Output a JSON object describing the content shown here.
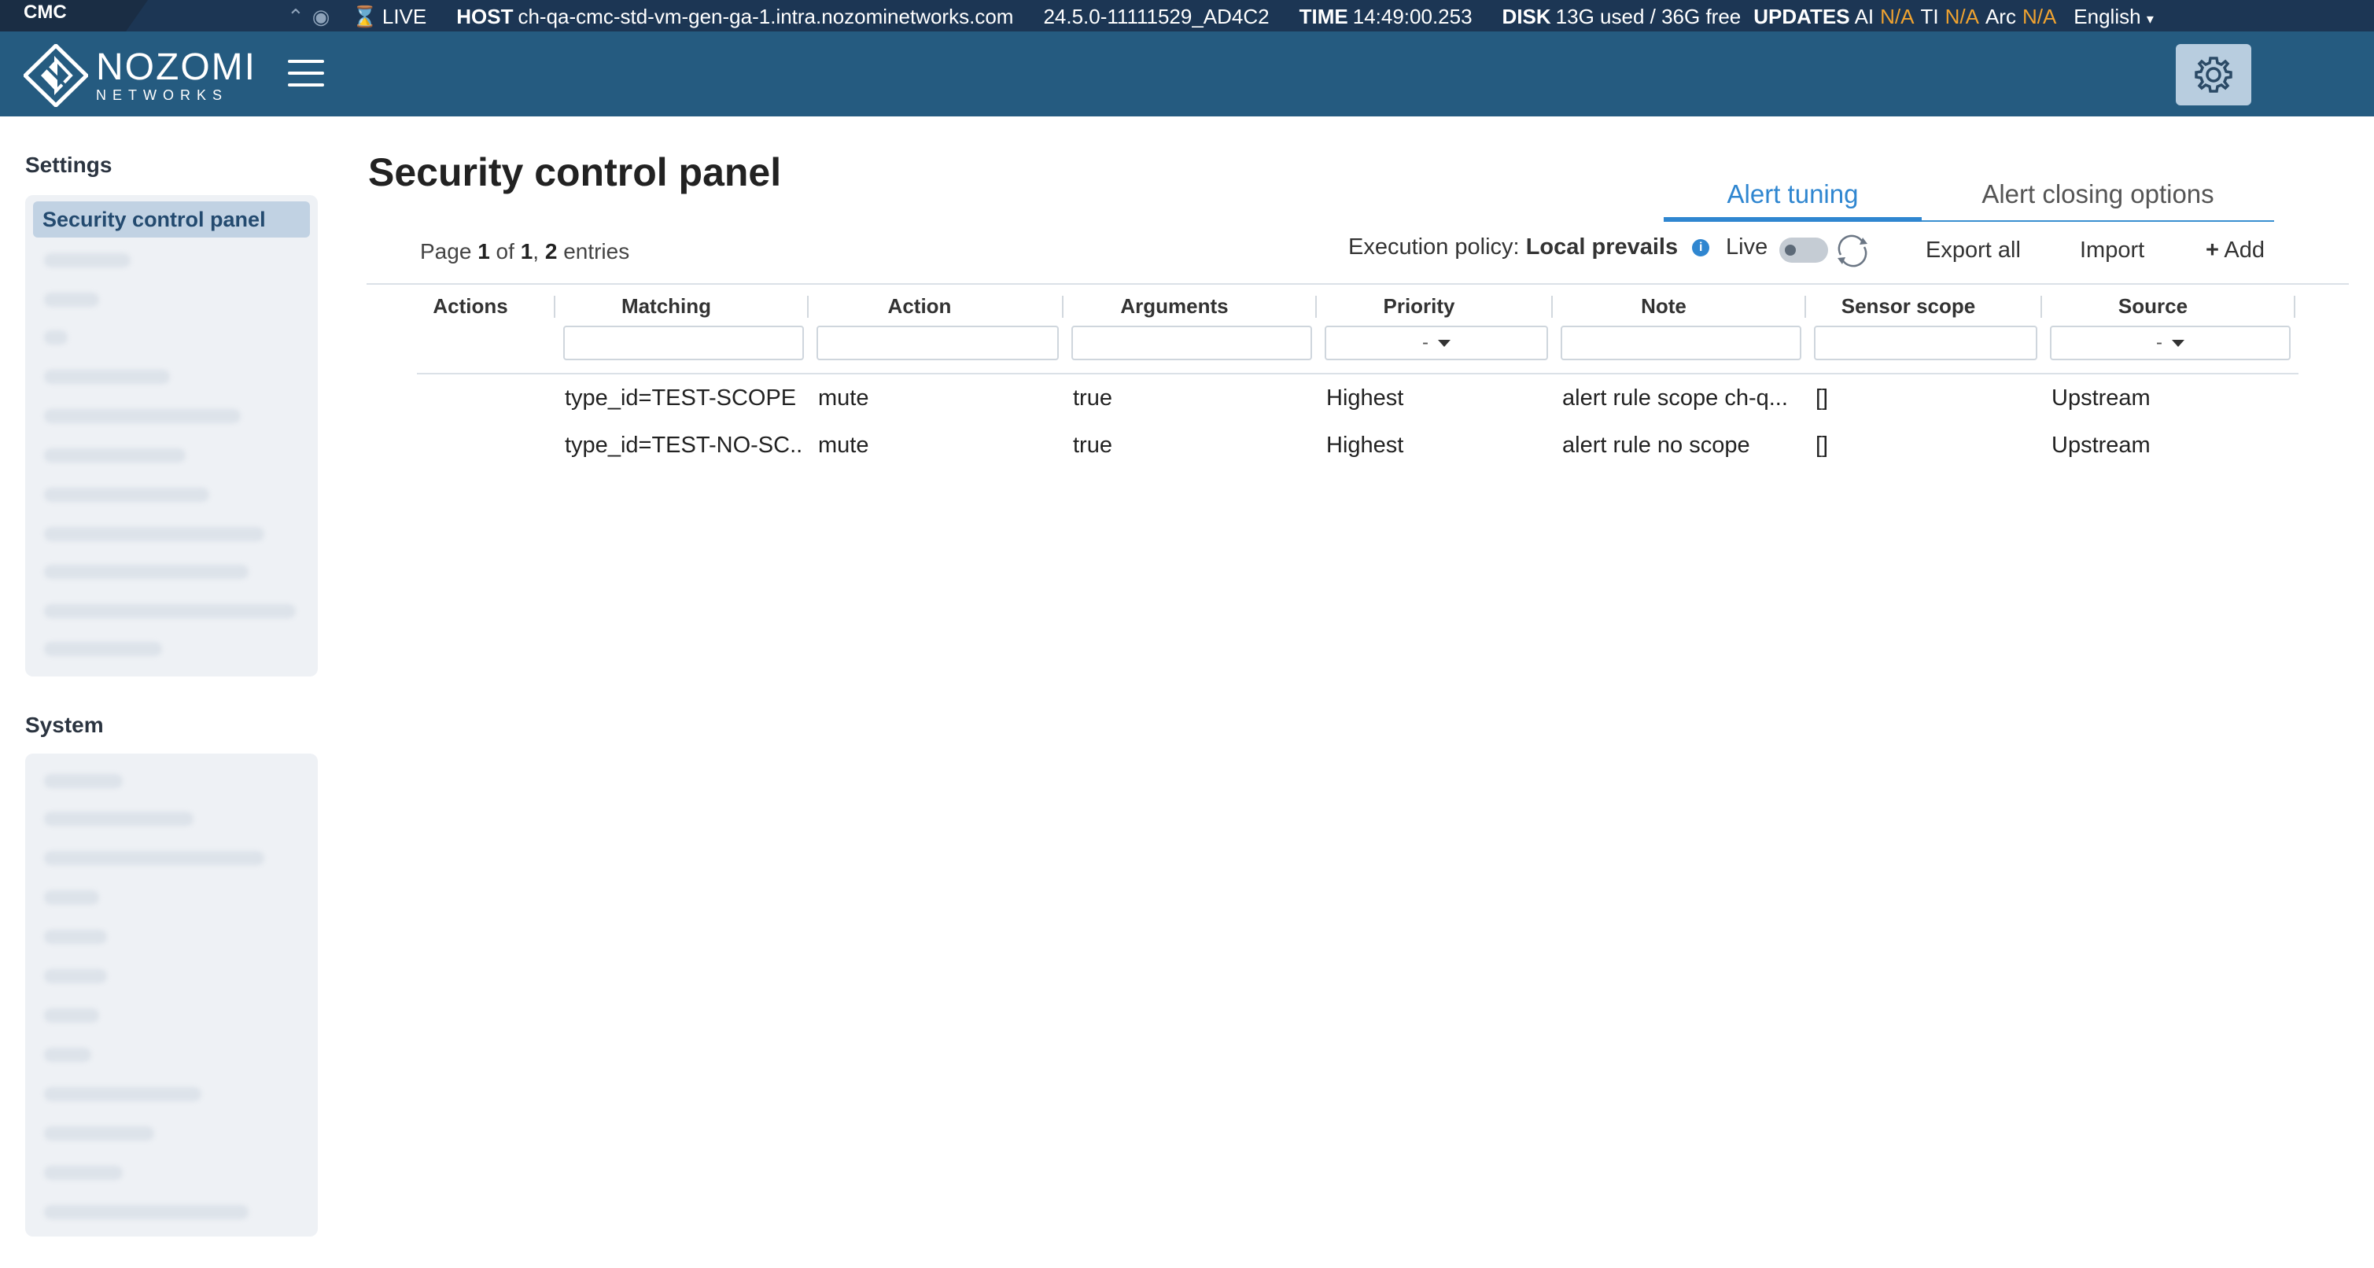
{
  "statusbar": {
    "product": "CMC",
    "live_label": "LIVE",
    "host_key": "HOST",
    "host_value": "ch-qa-cmc-std-vm-gen-ga-1.intra.nozominetworks.com",
    "version": "24.5.0-11111529_AD4C2",
    "time_key": "TIME",
    "time_value": "14:49:00.253",
    "disk_key": "DISK",
    "disk_value": "13G used / 36G free",
    "updates_key": "UPDATES",
    "updates_ai": "AI",
    "updates_ai_value": "N/A",
    "updates_ti": "TI",
    "updates_ti_value": "N/A",
    "updates_arc": "Arc",
    "updates_arc_value": "N/A",
    "language": "English",
    "accent_color": "#f0a330"
  },
  "header": {
    "logo_line1": "NOZOMI",
    "logo_line2": "NETWORKS",
    "background_color": "#255b80"
  },
  "sidebar": {
    "settings_title": "Settings",
    "active_item": "Security control panel",
    "system_title": "System"
  },
  "main": {
    "title": "Security control panel",
    "tabs": [
      {
        "label": "Alert tuning",
        "active": true
      },
      {
        "label": "Alert closing options",
        "active": false
      }
    ],
    "pager": {
      "prefix": "Page",
      "page": "1",
      "of": "of",
      "total_pages": "1",
      "entries": "2",
      "entries_label": "entries"
    },
    "execution_policy_label": "Execution policy:",
    "execution_policy_value": "Local prevails",
    "live_label": "Live",
    "export_label": "Export all",
    "import_label": "Import",
    "add_label": "Add"
  },
  "table": {
    "columns": [
      "Actions",
      "Matching",
      "Action",
      "Arguments",
      "Priority",
      "Note",
      "Sensor scope",
      "Source"
    ],
    "priority_filter": "-",
    "source_filter": "-",
    "rows": [
      {
        "matching": "type_id=TEST-SCOPE",
        "action": "mute",
        "arguments": "true",
        "priority": "Highest",
        "note": "alert rule scope ch-q...",
        "scope": "[]",
        "source": "Upstream"
      },
      {
        "matching": "type_id=TEST-NO-SC...",
        "action": "mute",
        "arguments": "true",
        "priority": "Highest",
        "note": "alert rule no scope",
        "scope": "[]",
        "source": "Upstream"
      }
    ]
  }
}
